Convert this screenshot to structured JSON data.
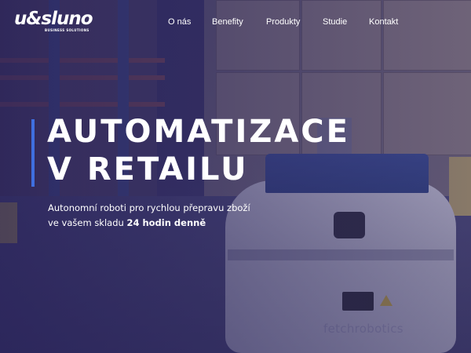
{
  "header": {
    "logo_text": "u&sluno",
    "logo_tagline": "BUSINESS SOLUTIONS",
    "nav": [
      {
        "label": "O nás"
      },
      {
        "label": "Benefity"
      },
      {
        "label": "Produkty"
      },
      {
        "label": "Studie"
      },
      {
        "label": "Kontakt"
      }
    ]
  },
  "hero": {
    "title_line1": "AUTOMATIZACE",
    "title_line2": "V RETAILU",
    "subtitle_line1": "Autonomní roboti pro rychlou přepravu zboží",
    "subtitle_line2_prefix": "ve vašem skladu ",
    "subtitle_line2_bold": "24 hodin denně",
    "accent_color": "#3f6fe0"
  },
  "background": {
    "robot_brand": "fetchrobotics"
  }
}
